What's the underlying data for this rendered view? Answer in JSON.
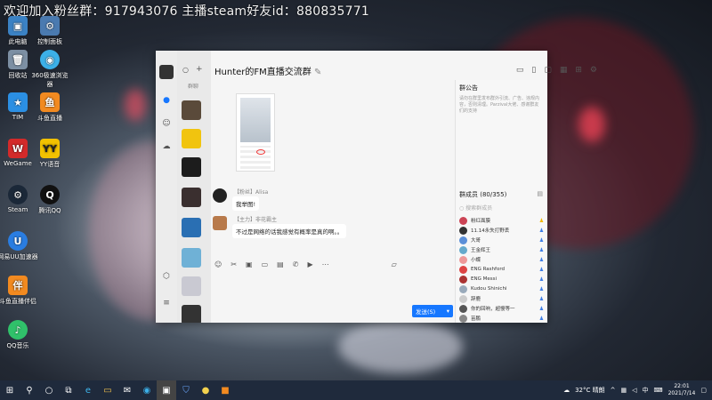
{
  "overlay": {
    "text": "欢迎加入粉丝群：917943076 主播steam好友id：880835771"
  },
  "desktop_icons": [
    {
      "label": "此电脑",
      "icon": "computer-icon",
      "color": "#3b82c4"
    },
    {
      "label": "控制面板",
      "icon": "control-panel-icon",
      "color": "#4a7ab0"
    },
    {
      "label": "回收站",
      "icon": "recycle-bin-icon",
      "color": "#7c8fa3"
    },
    {
      "label": "360极速浏览器",
      "icon": "browser-icon",
      "color": "#3cb0e8"
    },
    {
      "label": "TIM",
      "icon": "tim-icon",
      "color": "#2b8fe3"
    },
    {
      "label": "斗鱼直播",
      "icon": "douyu-icon",
      "color": "#f28a20"
    },
    {
      "label": "WeGame",
      "icon": "wegame-icon",
      "color": "#d32a2a"
    },
    {
      "label": "YY语音",
      "icon": "yy-icon",
      "color": "#f2c100"
    },
    {
      "label": "Steam",
      "icon": "steam-icon",
      "color": "#1b2838"
    },
    {
      "label": "腾讯QQ",
      "icon": "qq-icon",
      "color": "#111111"
    },
    {
      "label": "网易UU加速器",
      "icon": "uu-icon",
      "color": "#2a7de1"
    },
    {
      "label": "斗鱼直播伴侣",
      "icon": "douyu-companion-icon",
      "color": "#f28a20"
    },
    {
      "label": "QQ音乐",
      "icon": "qqmusic-icon",
      "color": "#30c16a"
    }
  ],
  "window": {
    "title": "Hunter的FM直播交流群",
    "search_hint": "群聊",
    "messages": [
      {
        "sender": "【粉丝】Alisa",
        "text": "我举图!"
      },
      {
        "sender": "【主力】非花霸主",
        "text": "不过是网络的话我感觉有概率是真的啊。。"
      }
    ],
    "send_label": "发送(S)",
    "side": {
      "notice_title": "群公告",
      "notice_text": "请勿在群里发布群外引流、广告、违规内容，否则清理。Parzival大佬、感谢群友们的支持",
      "members_title": "群成员 (80/355)",
      "search_placeholder": "搜索群成员",
      "members": [
        {
          "name": "粉红面膜",
          "role": "owner"
        },
        {
          "name": "11.14永失打野丢",
          "role": "admin"
        },
        {
          "name": "大哥",
          "role": "member"
        },
        {
          "name": "王金辉王",
          "role": "member"
        },
        {
          "name": "小蝶",
          "role": "member"
        },
        {
          "name": "ENG Rashford",
          "role": "member"
        },
        {
          "name": "ENG Messi",
          "role": "member"
        },
        {
          "name": "Kudou Shinichi",
          "role": "member"
        },
        {
          "name": "辞鹿",
          "role": "member"
        },
        {
          "name": "你的回响，超慢等一",
          "role": "member"
        },
        {
          "name": "苗鹏",
          "role": "member"
        }
      ]
    }
  },
  "taskbar": {
    "weather": "32°C 晴朗",
    "ime": "中",
    "time": "22:01",
    "date": "2021/7/14"
  }
}
